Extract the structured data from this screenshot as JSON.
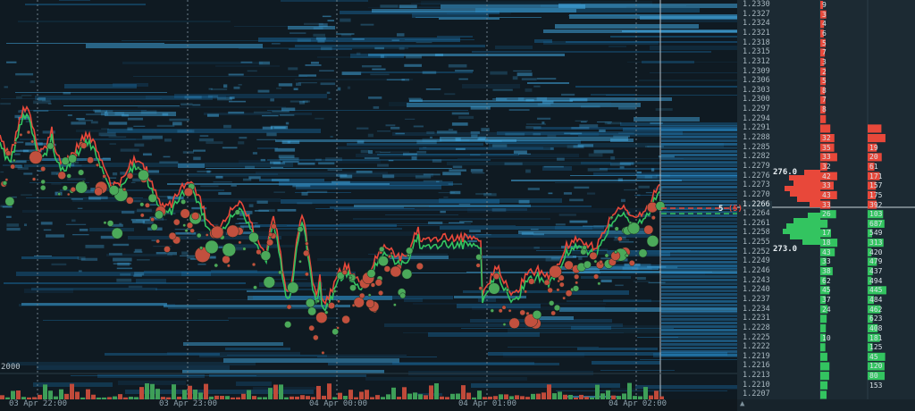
{
  "time_axis": {
    "labels": [
      "03 Apr 22:00",
      "03 Apr 23:00",
      "04 Apr 00:00",
      "04 Apr 01:00",
      "04 Apr 02:00"
    ]
  },
  "volume_scale_label": "2000",
  "price_axis": {
    "labels": [
      "1.2330",
      "1.2327",
      "1.2324",
      "1.2321",
      "1.2318",
      "1.2315",
      "1.2312",
      "1.2309",
      "1.2306",
      "1.2303",
      "1.2300",
      "1.2297",
      "1.2294",
      "1.2291",
      "1.2288",
      "1.2285",
      "1.2282",
      "1.2279",
      "1.2276",
      "1.2273",
      "1.2270",
      "1.2266",
      "1.2264",
      "1.2261",
      "1.2258",
      "1.2255",
      "1.2252",
      "1.2249",
      "1.2246",
      "1.2243",
      "1.2240",
      "1.2237",
      "1.2234",
      "1.2231",
      "1.2228",
      "1.2225",
      "1.2222",
      "1.2219",
      "1.2216",
      "1.2213",
      "1.2210",
      "1.2207"
    ],
    "current_price": "1.2266"
  },
  "order_marker": {
    "label": "5",
    "sub_label": "(5)"
  },
  "profile_tags": {
    "upper_total": "276.0",
    "lower_total": "273.0"
  },
  "ask_column_values": [
    "9",
    "3",
    "4",
    "6",
    "5",
    "7",
    "3",
    "2",
    "5",
    "8",
    "7",
    "8",
    "",
    "",
    "32",
    "35",
    "33",
    "32",
    "42",
    "33",
    "43",
    "33",
    "26"
  ],
  "bid_column_values": [
    "17",
    "18",
    "43",
    "33",
    "38",
    "62",
    "45",
    "37",
    "24",
    "",
    "",
    "10",
    "",
    "",
    "",
    "",
    "",
    "",
    "",
    "",
    "",
    "",
    "",
    ""
  ],
  "cum_column_values": [
    [
      "19",
      "20",
      "61",
      "171",
      "157",
      "175",
      "392",
      "103",
      "687",
      "549",
      "313",
      "420",
      "479",
      "437",
      "494",
      "445",
      "484",
      "462",
      "623",
      "408",
      "181",
      "125",
      "45",
      "120",
      "80",
      "153"
    ]
  ],
  "colors": {
    "ask": "#e8483a",
    "bid": "#33c460",
    "heat_light": "#46b4f0",
    "heat_dark": "#0c3550",
    "background": "#0f1a22"
  },
  "icons": {
    "side_bottom": "chevron-up-icon"
  }
}
